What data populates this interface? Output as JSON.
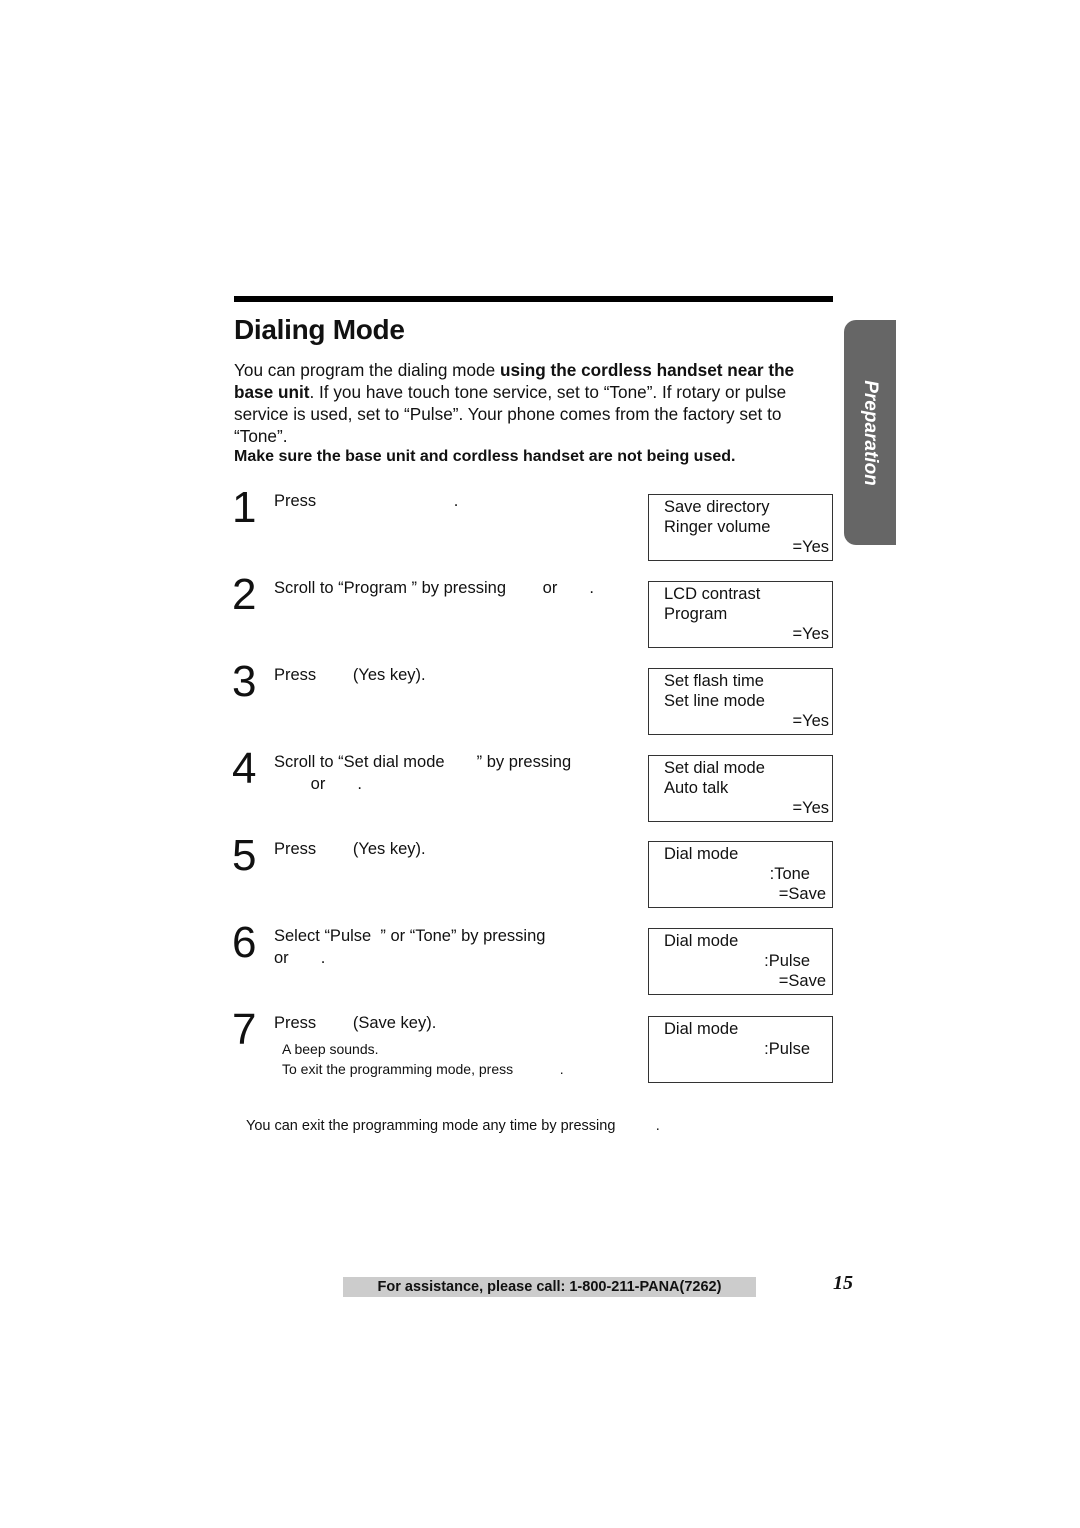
{
  "section": {
    "title": "Dialing Mode",
    "side_tab": "Preparation",
    "intro": {
      "part1": "You can program the dialing mode ",
      "bold1": "using the cordless handset near the base unit",
      "part2": ". If you have touch tone service, set to “Tone”. If rotary or pulse service is used, set to “Pulse”. Your phone comes from the factory set to “Tone”."
    },
    "warning": "Make sure the base unit and cordless handset are not being used."
  },
  "steps": [
    {
      "num": "1",
      "text": "Press                              ."
    },
    {
      "num": "2",
      "text": "Scroll to “Program ” by pressing        or       ."
    },
    {
      "num": "3",
      "text": "Press        (Yes key)."
    },
    {
      "num": "4",
      "text": "Scroll to “Set dial mode       ” by pressing\n        or       ."
    },
    {
      "num": "5",
      "text": "Press        (Yes key)."
    },
    {
      "num": "6",
      "text": "Select “Pulse  ” or “Tone” by pressing\nor       ."
    },
    {
      "num": "7",
      "text": "Press        (Save key).",
      "sub1": "A beep sounds.",
      "sub2": "To exit the programming mode, press            ."
    }
  ],
  "lcd_displays": [
    {
      "line1": "Save directory",
      "line2": "Ringer volume",
      "line3": "=Yes"
    },
    {
      "line1": "LCD contrast",
      "line2": "Program",
      "line3": "=Yes"
    },
    {
      "line1": "Set flash time",
      "line2": "Set line mode",
      "line3": "=Yes"
    },
    {
      "line1": "Set dial mode",
      "line2": "Auto talk",
      "line3": "=Yes"
    },
    {
      "line1": "Dial mode",
      "line2": ":Tone",
      "line3": "=Save"
    },
    {
      "line1": "Dial mode",
      "line2": ":Pulse",
      "line3": "=Save"
    },
    {
      "line1": "Dial mode",
      "line2": ":Pulse",
      "line3": ""
    }
  ],
  "note": "You can exit the programming mode any time by pressing          .",
  "footer": {
    "assistance": "For assistance, please call: 1-800-211-PANA(7262)",
    "page_number": "15"
  }
}
